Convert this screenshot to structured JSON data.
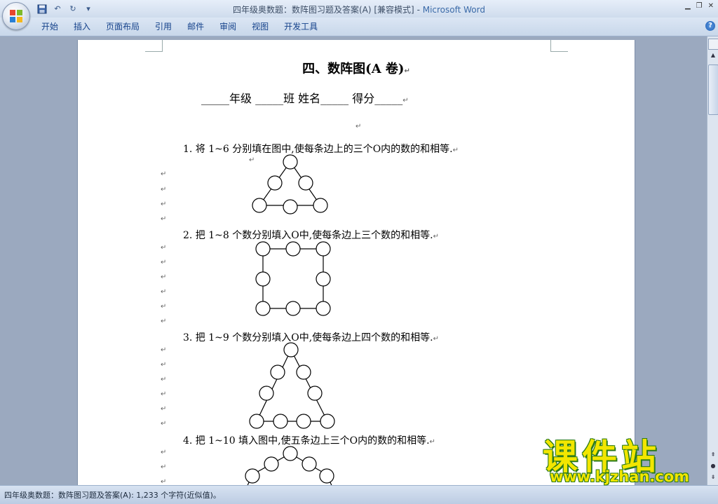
{
  "window": {
    "title": "四年级奥数题：数阵图习题及答案(A) [兼容模式]",
    "separator": " - ",
    "app_name": "Microsoft Word",
    "controls": [
      "▁",
      "❐",
      "✕"
    ]
  },
  "quick_access": {
    "save_icon": "save-icon",
    "undo_icon": "undo-icon",
    "redo_icon": "redo-icon",
    "customize_icon": "customize-icon",
    "undo_glyph": "↶",
    "redo_glyph": "↻",
    "customize_glyph": "▾"
  },
  "ribbon": {
    "tabs": [
      "开始",
      "插入",
      "页面布局",
      "引用",
      "邮件",
      "审阅",
      "视图",
      "开发工具"
    ],
    "help_glyph": "?"
  },
  "document": {
    "heading": "四、数阵图(A 卷)",
    "info_line": "_____年级 _____班              姓名_____  得分_____",
    "para_mark": "↵",
    "questions": [
      "1.  将 1~6 分别填在图中,使每条边上的三个O内的数的和相等.",
      "2.  把 1~8 个数分别填入O中,使每条边上三个数的和相等.",
      "3.  把 1~9 个数分别填入O中,使每条边上四个数的和相等.",
      "4.  把 1~10 填入图中,使五条边上三个O内的数的和相等."
    ]
  },
  "status_bar": {
    "text": "四年级奥数题：数阵图习题及答案(A): 1,233 个字符(近似值)。"
  },
  "watermark": {
    "title": "课件站",
    "url": "www.kjzhan.com"
  },
  "scrollbar": {
    "up_glyph": "▲",
    "prev_glyph": "⇞",
    "select_glyph": "●",
    "next_glyph": "⇟"
  }
}
